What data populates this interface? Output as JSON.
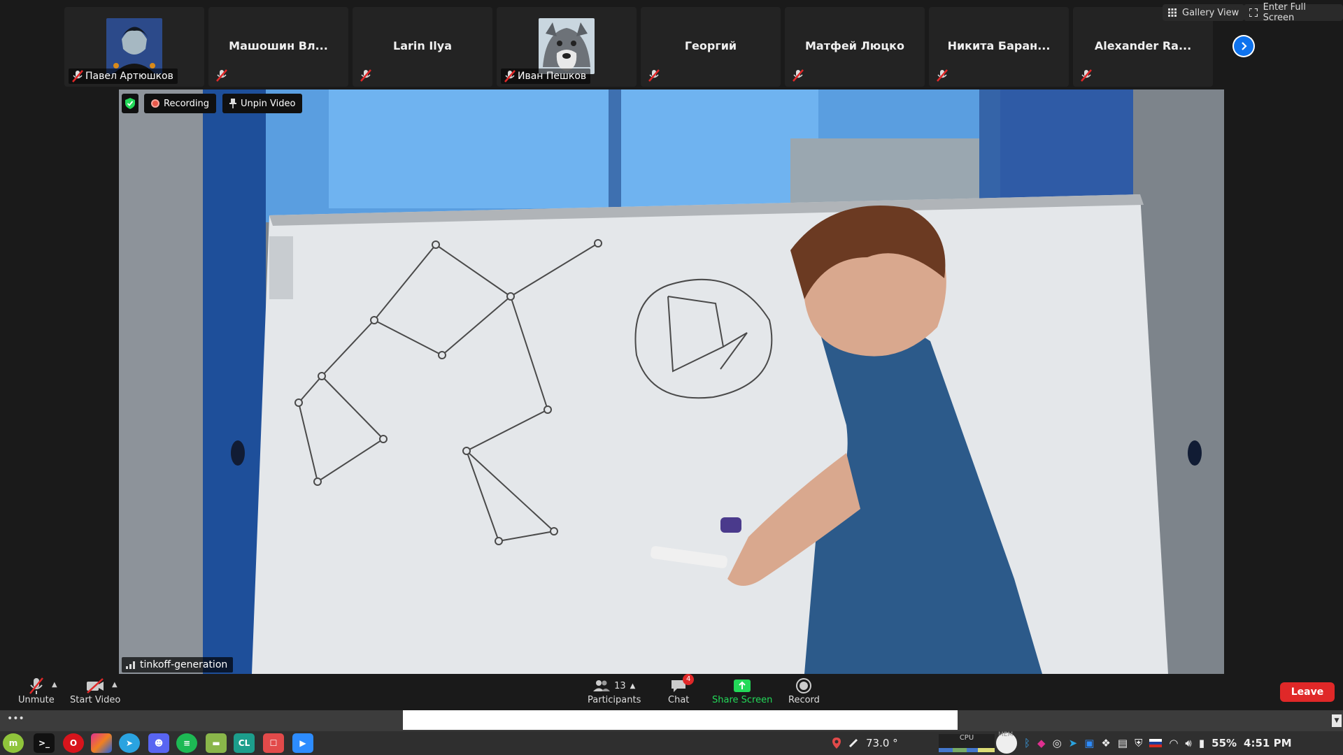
{
  "top_bar": {
    "gallery_view": "Gallery View",
    "full_screen": "Enter Full Screen"
  },
  "participants": [
    {
      "name": "Павел Артюшков",
      "has_avatar": true
    },
    {
      "name": "Машошин Вл...",
      "has_avatar": false
    },
    {
      "name": "Larin Ilya",
      "has_avatar": false
    },
    {
      "name": "Иван Пешков",
      "has_avatar": true
    },
    {
      "name": "Георгий",
      "has_avatar": false
    },
    {
      "name": "Матфей Люцко",
      "has_avatar": false
    },
    {
      "name": "Никита Баран...",
      "has_avatar": false
    },
    {
      "name": "Alexander Ra...",
      "has_avatar": false
    }
  ],
  "video": {
    "recording_label": "Recording",
    "unpin_label": "Unpin Video",
    "network_name": "tinkoff-generation"
  },
  "toolbar": {
    "unmute": "Unmute",
    "start_video": "Start Video",
    "participants_label": "Participants",
    "participants_count": "13",
    "chat": "Chat",
    "chat_badge": "4",
    "share_screen": "Share Screen",
    "record": "Record",
    "leave": "Leave"
  },
  "taskbar": {
    "temperature": "73.0 °",
    "cpu_label": "CPU",
    "mem_label": "MEM",
    "battery": "55%",
    "clock": "4:51 PM"
  },
  "colors": {
    "accent_blue": "#0e72ed",
    "leave_red": "#e02828",
    "share_green": "#23d959",
    "muted_red": "#e02828"
  }
}
